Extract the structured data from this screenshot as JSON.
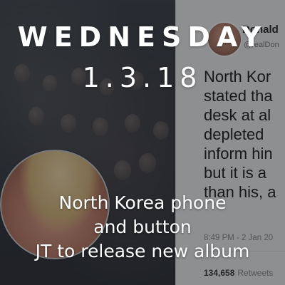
{
  "header": {
    "day": "WEDNESDAY",
    "date": "1.3.18"
  },
  "stories": [
    {
      "text": "North Korea phone"
    },
    {
      "text": "and button"
    },
    {
      "text": "JT to release new album"
    }
  ],
  "tweet": {
    "name": "Donald",
    "handle": "@realDon",
    "lines": [
      "North Kor",
      "stated tha",
      "desk at al",
      "depleted",
      "inform hin",
      "but it is a",
      "than his, a"
    ],
    "timestamp": "8:49 PM - 2 Jan 20",
    "retweets_count": "134,658",
    "retweets_label": "Retweets"
  },
  "colors": {
    "overlay": "#141619",
    "text": "#ffffff",
    "card": "#f2f2f2"
  }
}
